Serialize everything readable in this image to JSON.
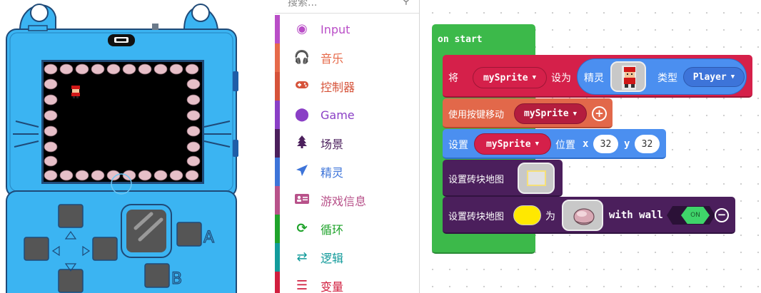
{
  "toolbox": {
    "search_placeholder": "搜索...",
    "categories": [
      {
        "label": "Input",
        "color": "#b94ec7",
        "icon": "input-icon"
      },
      {
        "label": "音乐",
        "color": "#e66a4a",
        "icon": "headphones-icon"
      },
      {
        "label": "控制器",
        "color": "#d6533a",
        "icon": "gamepad-icon"
      },
      {
        "label": "Game",
        "color": "#8a3fc6",
        "icon": "circle-icon"
      },
      {
        "label": "场景",
        "color": "#4b1f5c",
        "icon": "tree-icon"
      },
      {
        "label": "精灵",
        "color": "#3d74d9",
        "icon": "paper-plane-icon"
      },
      {
        "label": "游戏信息",
        "color": "#b8528a",
        "icon": "id-card-icon"
      },
      {
        "label": "循环",
        "color": "#1fa32b",
        "icon": "loop-icon"
      },
      {
        "label": "逻辑",
        "color": "#129b9b",
        "icon": "shuffle-icon"
      },
      {
        "label": "变量",
        "color": "#d11f3f",
        "icon": "list-icon"
      }
    ]
  },
  "workspace": {
    "on_start": {
      "label": "on start",
      "color": "#3cb94a"
    },
    "set_sprite": {
      "prefix": "将",
      "var": "mySprite",
      "mid": "设为",
      "sprite_label": "精灵",
      "type_label": "类型",
      "type_value": "Player",
      "color": "#d5204a",
      "inner_color": "#4b8ff0"
    },
    "move_buttons": {
      "label": "使用按键移动",
      "var": "mySprite",
      "color": "#e2684a"
    },
    "set_position": {
      "prefix": "设置",
      "var": "mySprite",
      "mid": "位置",
      "x_label": "x",
      "x": "32",
      "y_label": "y",
      "y": "32",
      "color": "#4b8ff0"
    },
    "set_tilemap": {
      "label": "设置砖块地图",
      "color": "#4b1f5c"
    },
    "set_tile": {
      "label": "设置砖块地图",
      "to": "为",
      "wall_label": "with wall",
      "toggle_value": "ON",
      "color": "#4b1f5c",
      "toggle_color": "#3fd46a"
    }
  }
}
